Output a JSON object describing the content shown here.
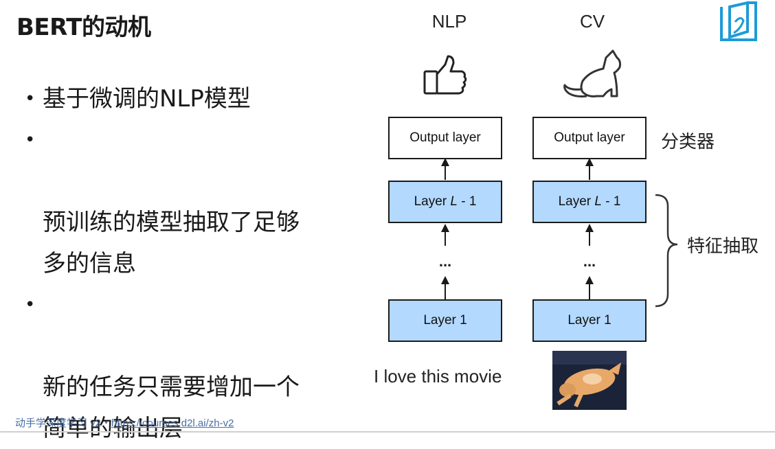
{
  "slide": {
    "title": "BERT的动机",
    "bullets": [
      "基于微调的NLP模型",
      "预训练的模型抽取了足够\n多的信息",
      "新的任务只需要增加一个\n简单的输出层"
    ]
  },
  "diagram": {
    "columns": [
      {
        "header": "NLP",
        "icon": "thumbs-up-icon",
        "output_label": "Output layer",
        "layer_top_prefix": "Layer ",
        "layer_top_var": "L",
        "layer_top_suffix": " - 1",
        "ellipsis": "...",
        "layer_bottom": "Layer 1",
        "input": "I love this movie"
      },
      {
        "header": "CV",
        "icon": "cat-icon",
        "output_label": "Output layer",
        "layer_top_prefix": "Layer ",
        "layer_top_var": "L",
        "layer_top_suffix": " - 1",
        "ellipsis": "...",
        "layer_bottom": "Layer 1",
        "input_image": "cat-photo"
      }
    ],
    "classifier_label": "分类器",
    "feature_label": "特征抽取",
    "colors": {
      "layer_fill": "#b3d9ff",
      "border": "#1a1a1a"
    }
  },
  "footer": {
    "text": "动手学深度学习 v2・",
    "link": "https://courses.d2l.ai/zh-v2"
  }
}
